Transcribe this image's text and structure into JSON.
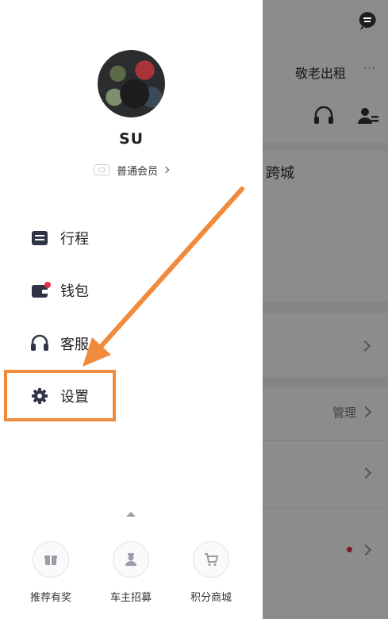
{
  "background": {
    "app_title": "敬老出租",
    "more_label": "···",
    "cross_city_label": "跨城",
    "manage_label": "管理"
  },
  "drawer": {
    "username": "SU",
    "member_level": "普通会员",
    "menu": [
      {
        "label": "行程",
        "icon": "itinerary-icon"
      },
      {
        "label": "钱包",
        "icon": "wallet-icon"
      },
      {
        "label": "客服",
        "icon": "headset-icon"
      },
      {
        "label": "设置",
        "icon": "gear-icon"
      }
    ],
    "bottom_links": [
      {
        "label": "推荐有奖",
        "icon": "gift-icon"
      },
      {
        "label": "车主招募",
        "icon": "driver-icon"
      },
      {
        "label": "积分商城",
        "icon": "cart-icon"
      }
    ]
  },
  "colors": {
    "highlight": "#f08a3c",
    "badge": "#e8314d"
  }
}
